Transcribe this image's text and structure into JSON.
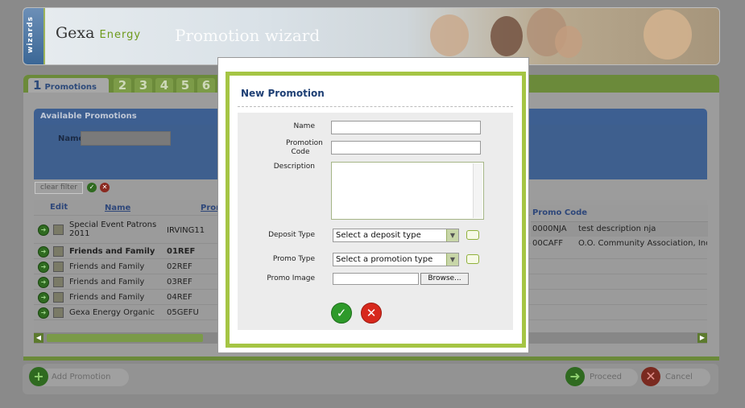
{
  "app": {
    "logo": "Gexa",
    "logo_energy": "Energy",
    "title": "Promotion wizard",
    "side_tab": "wizards"
  },
  "steps": {
    "active_number": "1",
    "active_label": "Promotions",
    "others": [
      "2",
      "3",
      "4",
      "5",
      "6"
    ]
  },
  "available": {
    "header": "Available Promotions",
    "filter_label": "Name",
    "clear_filter": "clear filter",
    "columns": {
      "edit": "Edit",
      "name": "Name",
      "promo": "Prom"
    },
    "rows": [
      {
        "name": "Special Event Patrons 2011",
        "code": "IRVING11"
      },
      {
        "name": "Friends and Family",
        "code": "01REF"
      },
      {
        "name": "Friends and Family",
        "code": "02REF"
      },
      {
        "name": "Friends and Family",
        "code": "03REF"
      },
      {
        "name": "Friends and Family",
        "code": "04REF"
      },
      {
        "name": "Gexa Energy Organic",
        "code": "05GEFU"
      }
    ],
    "right_header": "Promo Code",
    "right_rows": [
      {
        "code": "0000NJA",
        "desc": "test description nja"
      },
      {
        "code": "00CAFF",
        "desc": "O.O. Community Association, Inc. m"
      }
    ]
  },
  "footer": {
    "add": "Add Promotion",
    "proceed": "Proceed",
    "cancel": "Cancel"
  },
  "modal": {
    "title": "New Promotion",
    "labels": {
      "name": "Name",
      "code": "Promotion Code",
      "description": "Description",
      "deposit": "Deposit Type",
      "promo_type": "Promo Type",
      "image": "Promo Image"
    },
    "deposit_placeholder": "Select a deposit type",
    "promo_type_placeholder": "Select a promotion type",
    "browse": "Browse..."
  },
  "colors": {
    "accent_green": "#a5c544",
    "brand_blue": "#1e3f74",
    "ok_green": "#2e9a2a",
    "cancel_red": "#d7281c"
  }
}
